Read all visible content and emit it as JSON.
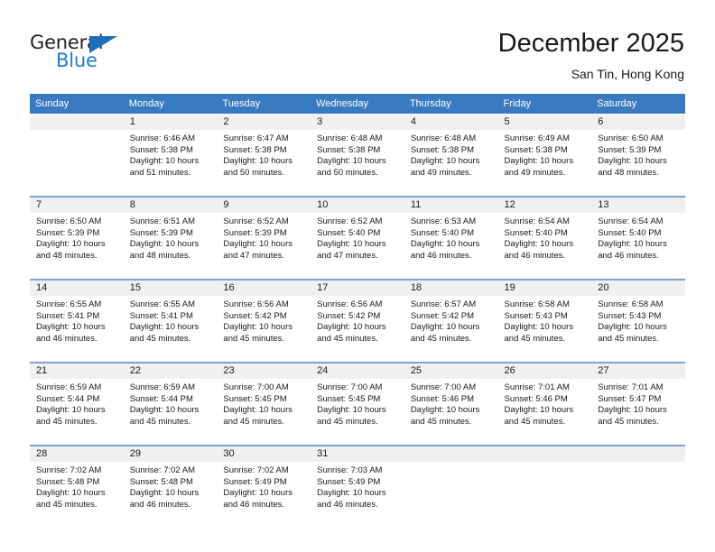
{
  "logo": {
    "text_dark": "General",
    "text_blue": "Blue",
    "triangle_color": "#1d6fb8",
    "blue_color": "#1d7fd0"
  },
  "header": {
    "title": "December 2025",
    "subtitle": "San Tin, Hong Kong"
  },
  "theme": {
    "header_bg": "#3a7ac0",
    "daynum_bg": "#f0f0f0",
    "row_divider": "#7aa4cf"
  },
  "weekdays": [
    "Sunday",
    "Monday",
    "Tuesday",
    "Wednesday",
    "Thursday",
    "Friday",
    "Saturday"
  ],
  "weeks": [
    [
      {
        "day": "",
        "sunrise": "",
        "sunset": "",
        "daylight_line1": "",
        "daylight_line2": "",
        "empty": true
      },
      {
        "day": "1",
        "sunrise": "Sunrise: 6:46 AM",
        "sunset": "Sunset: 5:38 PM",
        "daylight_line1": "Daylight: 10 hours",
        "daylight_line2": "and 51 minutes."
      },
      {
        "day": "2",
        "sunrise": "Sunrise: 6:47 AM",
        "sunset": "Sunset: 5:38 PM",
        "daylight_line1": "Daylight: 10 hours",
        "daylight_line2": "and 50 minutes."
      },
      {
        "day": "3",
        "sunrise": "Sunrise: 6:48 AM",
        "sunset": "Sunset: 5:38 PM",
        "daylight_line1": "Daylight: 10 hours",
        "daylight_line2": "and 50 minutes."
      },
      {
        "day": "4",
        "sunrise": "Sunrise: 6:48 AM",
        "sunset": "Sunset: 5:38 PM",
        "daylight_line1": "Daylight: 10 hours",
        "daylight_line2": "and 49 minutes."
      },
      {
        "day": "5",
        "sunrise": "Sunrise: 6:49 AM",
        "sunset": "Sunset: 5:38 PM",
        "daylight_line1": "Daylight: 10 hours",
        "daylight_line2": "and 49 minutes."
      },
      {
        "day": "6",
        "sunrise": "Sunrise: 6:50 AM",
        "sunset": "Sunset: 5:39 PM",
        "daylight_line1": "Daylight: 10 hours",
        "daylight_line2": "and 48 minutes."
      }
    ],
    [
      {
        "day": "7",
        "sunrise": "Sunrise: 6:50 AM",
        "sunset": "Sunset: 5:39 PM",
        "daylight_line1": "Daylight: 10 hours",
        "daylight_line2": "and 48 minutes."
      },
      {
        "day": "8",
        "sunrise": "Sunrise: 6:51 AM",
        "sunset": "Sunset: 5:39 PM",
        "daylight_line1": "Daylight: 10 hours",
        "daylight_line2": "and 48 minutes."
      },
      {
        "day": "9",
        "sunrise": "Sunrise: 6:52 AM",
        "sunset": "Sunset: 5:39 PM",
        "daylight_line1": "Daylight: 10 hours",
        "daylight_line2": "and 47 minutes."
      },
      {
        "day": "10",
        "sunrise": "Sunrise: 6:52 AM",
        "sunset": "Sunset: 5:40 PM",
        "daylight_line1": "Daylight: 10 hours",
        "daylight_line2": "and 47 minutes."
      },
      {
        "day": "11",
        "sunrise": "Sunrise: 6:53 AM",
        "sunset": "Sunset: 5:40 PM",
        "daylight_line1": "Daylight: 10 hours",
        "daylight_line2": "and 46 minutes."
      },
      {
        "day": "12",
        "sunrise": "Sunrise: 6:54 AM",
        "sunset": "Sunset: 5:40 PM",
        "daylight_line1": "Daylight: 10 hours",
        "daylight_line2": "and 46 minutes."
      },
      {
        "day": "13",
        "sunrise": "Sunrise: 6:54 AM",
        "sunset": "Sunset: 5:40 PM",
        "daylight_line1": "Daylight: 10 hours",
        "daylight_line2": "and 46 minutes."
      }
    ],
    [
      {
        "day": "14",
        "sunrise": "Sunrise: 6:55 AM",
        "sunset": "Sunset: 5:41 PM",
        "daylight_line1": "Daylight: 10 hours",
        "daylight_line2": "and 46 minutes."
      },
      {
        "day": "15",
        "sunrise": "Sunrise: 6:55 AM",
        "sunset": "Sunset: 5:41 PM",
        "daylight_line1": "Daylight: 10 hours",
        "daylight_line2": "and 45 minutes."
      },
      {
        "day": "16",
        "sunrise": "Sunrise: 6:56 AM",
        "sunset": "Sunset: 5:42 PM",
        "daylight_line1": "Daylight: 10 hours",
        "daylight_line2": "and 45 minutes."
      },
      {
        "day": "17",
        "sunrise": "Sunrise: 6:56 AM",
        "sunset": "Sunset: 5:42 PM",
        "daylight_line1": "Daylight: 10 hours",
        "daylight_line2": "and 45 minutes."
      },
      {
        "day": "18",
        "sunrise": "Sunrise: 6:57 AM",
        "sunset": "Sunset: 5:42 PM",
        "daylight_line1": "Daylight: 10 hours",
        "daylight_line2": "and 45 minutes."
      },
      {
        "day": "19",
        "sunrise": "Sunrise: 6:58 AM",
        "sunset": "Sunset: 5:43 PM",
        "daylight_line1": "Daylight: 10 hours",
        "daylight_line2": "and 45 minutes."
      },
      {
        "day": "20",
        "sunrise": "Sunrise: 6:58 AM",
        "sunset": "Sunset: 5:43 PM",
        "daylight_line1": "Daylight: 10 hours",
        "daylight_line2": "and 45 minutes."
      }
    ],
    [
      {
        "day": "21",
        "sunrise": "Sunrise: 6:59 AM",
        "sunset": "Sunset: 5:44 PM",
        "daylight_line1": "Daylight: 10 hours",
        "daylight_line2": "and 45 minutes."
      },
      {
        "day": "22",
        "sunrise": "Sunrise: 6:59 AM",
        "sunset": "Sunset: 5:44 PM",
        "daylight_line1": "Daylight: 10 hours",
        "daylight_line2": "and 45 minutes."
      },
      {
        "day": "23",
        "sunrise": "Sunrise: 7:00 AM",
        "sunset": "Sunset: 5:45 PM",
        "daylight_line1": "Daylight: 10 hours",
        "daylight_line2": "and 45 minutes."
      },
      {
        "day": "24",
        "sunrise": "Sunrise: 7:00 AM",
        "sunset": "Sunset: 5:45 PM",
        "daylight_line1": "Daylight: 10 hours",
        "daylight_line2": "and 45 minutes."
      },
      {
        "day": "25",
        "sunrise": "Sunrise: 7:00 AM",
        "sunset": "Sunset: 5:46 PM",
        "daylight_line1": "Daylight: 10 hours",
        "daylight_line2": "and 45 minutes."
      },
      {
        "day": "26",
        "sunrise": "Sunrise: 7:01 AM",
        "sunset": "Sunset: 5:46 PM",
        "daylight_line1": "Daylight: 10 hours",
        "daylight_line2": "and 45 minutes."
      },
      {
        "day": "27",
        "sunrise": "Sunrise: 7:01 AM",
        "sunset": "Sunset: 5:47 PM",
        "daylight_line1": "Daylight: 10 hours",
        "daylight_line2": "and 45 minutes."
      }
    ],
    [
      {
        "day": "28",
        "sunrise": "Sunrise: 7:02 AM",
        "sunset": "Sunset: 5:48 PM",
        "daylight_line1": "Daylight: 10 hours",
        "daylight_line2": "and 45 minutes."
      },
      {
        "day": "29",
        "sunrise": "Sunrise: 7:02 AM",
        "sunset": "Sunset: 5:48 PM",
        "daylight_line1": "Daylight: 10 hours",
        "daylight_line2": "and 46 minutes."
      },
      {
        "day": "30",
        "sunrise": "Sunrise: 7:02 AM",
        "sunset": "Sunset: 5:49 PM",
        "daylight_line1": "Daylight: 10 hours",
        "daylight_line2": "and 46 minutes."
      },
      {
        "day": "31",
        "sunrise": "Sunrise: 7:03 AM",
        "sunset": "Sunset: 5:49 PM",
        "daylight_line1": "Daylight: 10 hours",
        "daylight_line2": "and 46 minutes."
      },
      {
        "day": "",
        "sunrise": "",
        "sunset": "",
        "daylight_line1": "",
        "daylight_line2": "",
        "empty": true
      },
      {
        "day": "",
        "sunrise": "",
        "sunset": "",
        "daylight_line1": "",
        "daylight_line2": "",
        "empty": true
      },
      {
        "day": "",
        "sunrise": "",
        "sunset": "",
        "daylight_line1": "",
        "daylight_line2": "",
        "empty": true
      }
    ]
  ]
}
